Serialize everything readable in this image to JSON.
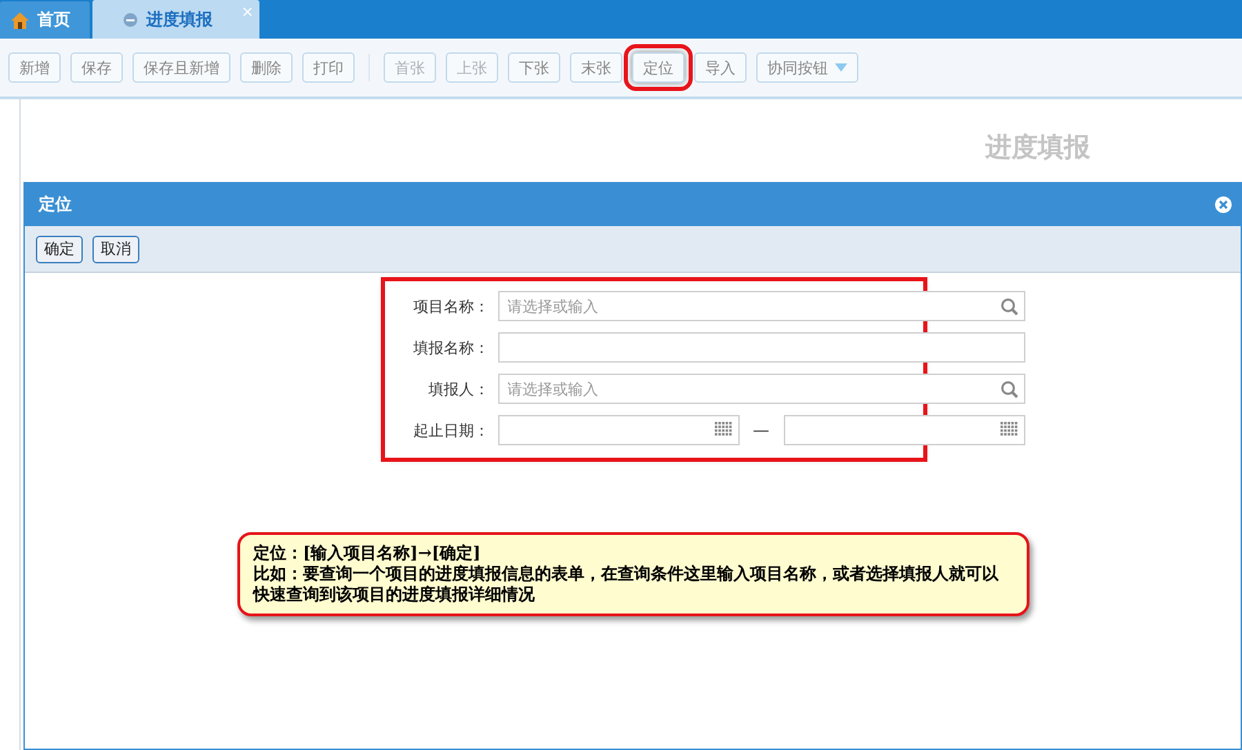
{
  "tabs": [
    {
      "label": "首页",
      "kind": "home",
      "selected": false
    },
    {
      "label": "进度填报",
      "kind": "page",
      "selected": true,
      "close_glyph": "×"
    }
  ],
  "toolbar": {
    "groups": [
      [
        {
          "label": "新增",
          "disabled": false,
          "highlighted": false,
          "kind": "button"
        },
        {
          "label": "保存",
          "disabled": false,
          "highlighted": false,
          "kind": "button"
        },
        {
          "label": "保存且新增",
          "disabled": false,
          "highlighted": false,
          "kind": "button"
        },
        {
          "label": "删除",
          "disabled": false,
          "highlighted": false,
          "kind": "button"
        },
        {
          "label": "打印",
          "disabled": false,
          "highlighted": false,
          "kind": "button"
        }
      ],
      [
        {
          "label": "首张",
          "disabled": true,
          "highlighted": false,
          "kind": "button"
        },
        {
          "label": "上张",
          "disabled": true,
          "highlighted": false,
          "kind": "button"
        },
        {
          "label": "下张",
          "disabled": false,
          "highlighted": false,
          "kind": "button"
        },
        {
          "label": "末张",
          "disabled": false,
          "highlighted": false,
          "kind": "button"
        },
        {
          "label": "定位",
          "disabled": false,
          "highlighted": true,
          "kind": "button"
        },
        {
          "label": "导入",
          "disabled": false,
          "highlighted": false,
          "kind": "button"
        },
        {
          "label": "协同按钮",
          "disabled": false,
          "highlighted": false,
          "kind": "dropdown"
        }
      ]
    ]
  },
  "page_title": "进度填报",
  "dialog": {
    "title": "定位",
    "buttons": [
      "确定",
      "取消"
    ],
    "form_highlighted": true,
    "fields": [
      {
        "label": "项目名称：",
        "kind": "lookup",
        "placeholder": "请选择或输入"
      },
      {
        "label": "填报名称：",
        "kind": "text"
      },
      {
        "label": "填报人：",
        "kind": "lookup",
        "placeholder": "请选择或输入"
      },
      {
        "label": "起止日期：",
        "kind": "daterange",
        "separator": "—"
      }
    ]
  },
  "note": {
    "title": "定位：[输入项目名称]→[确定]",
    "text": "比如：要查询一个项目的进度填报信息的表单，在查询条件这里输入项目名称，或者选择填报人就可以快速查询到该项目的进度填报详细情况"
  }
}
